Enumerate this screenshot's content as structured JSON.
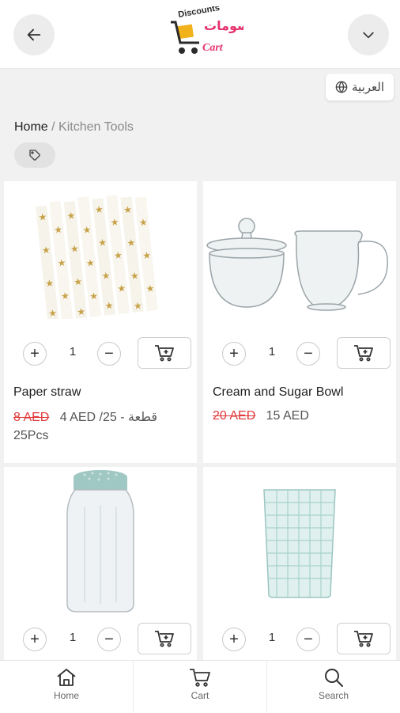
{
  "header": {
    "logo_text_top": "Discounts",
    "logo_text_bottom": "Cart",
    "logo_text_arabic": "سلة الخصومات"
  },
  "language": {
    "label": "العربية"
  },
  "breadcrumb": {
    "home": "Home",
    "separator": "/",
    "current": "Kitchen Tools"
  },
  "products": [
    {
      "name": "Paper straw",
      "old_price": "8 AED",
      "new_price": "4 AED /25 - قطعة",
      "unit": "25Pcs",
      "quantity": "1"
    },
    {
      "name": "Cream and Sugar Bowl",
      "old_price": "20 AED",
      "new_price": "15 AED",
      "quantity": "1"
    },
    {
      "name": "",
      "quantity": "1"
    },
    {
      "name": "",
      "quantity": "1"
    }
  ],
  "qty_controls": {
    "plus": "+",
    "minus": "−"
  },
  "bottom_nav": [
    {
      "label": "Home"
    },
    {
      "label": "Cart"
    },
    {
      "label": "Search"
    }
  ],
  "colors": {
    "accent_red": "#e03a3a",
    "logo_yellow": "#f2b21b",
    "logo_pink": "#e5336d"
  }
}
